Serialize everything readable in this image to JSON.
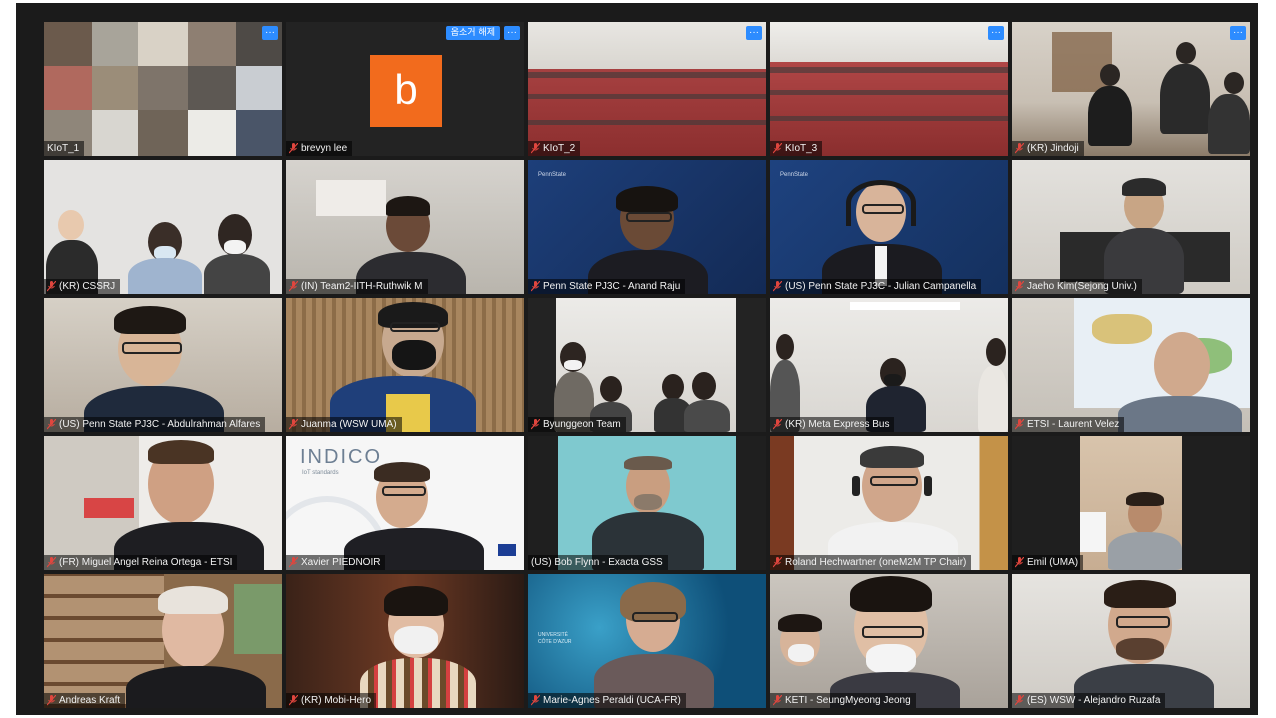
{
  "window": {
    "title": ""
  },
  "buttons": {
    "more": "···",
    "unpin": "옵소거 해제"
  },
  "avatar_letter": "b",
  "wall_text": {
    "indico": "INDICO",
    "indico_sub": "IoT standards",
    "pennstate": "PennState",
    "univ": "UNIVERSITÉ CÔTE D'AZUR"
  },
  "participants": [
    {
      "name": "KIoT_1"
    },
    {
      "name": "brevyn lee"
    },
    {
      "name": "KIoT_2"
    },
    {
      "name": "KIoT_3"
    },
    {
      "name": "(KR) Jindoji"
    },
    {
      "name": "(KR) CSSRJ"
    },
    {
      "name": "(IN) Team2-IITH-Ruthwik M"
    },
    {
      "name": "Penn State PJ3C - Anand Raju"
    },
    {
      "name": "(US) Penn State PJ3C - Julian Campanella"
    },
    {
      "name": "Jaeho Kim(Sejong Univ.)"
    },
    {
      "name": "(US) Penn State PJ3C - Abdulrahman Alfares"
    },
    {
      "name": "Juanma (WSW UMA)"
    },
    {
      "name": "Byunggeon Team"
    },
    {
      "name": "(KR) Meta Express Bus"
    },
    {
      "name": "ETSI - Laurent Velez"
    },
    {
      "name": "(FR) Miguel Angel Reina Ortega - ETSI"
    },
    {
      "name": "Xavier PIEDNOIR"
    },
    {
      "name": "(US) Bob Flynn - Exacta GSS"
    },
    {
      "name": "Roland Hechwartner (oneM2M TP Chair)"
    },
    {
      "name": "Emil (UMA)"
    },
    {
      "name": "Andreas Kraft"
    },
    {
      "name": "(KR) Mobi-Hero"
    },
    {
      "name": "Marie-Agnes Peraldi (UCA-FR)"
    },
    {
      "name": "KETI - SeungMyeong Jeong"
    },
    {
      "name": "(ES) WSW - Alejandro Ruzafa"
    }
  ],
  "colors": {
    "accent": "#2d8cff",
    "avatar_bg": "#f26b1d",
    "muted_mic": "#e0463e",
    "window_bg": "#1b1b1b"
  }
}
